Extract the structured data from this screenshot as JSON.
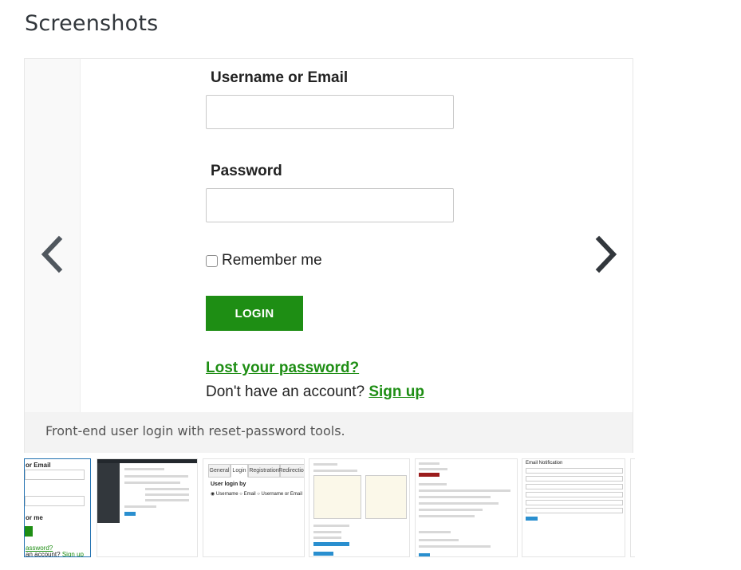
{
  "section": {
    "title": "Screenshots"
  },
  "slide": {
    "username_label": "Username or Email",
    "password_label": "Password",
    "remember_label": "Remember me",
    "login_button": "LOGIN",
    "lost_password": "Lost your password?",
    "no_account": "Don't have an account?",
    "signup_link": "Sign up",
    "caption": "Front-end user login with reset-password tools."
  },
  "navigation": {
    "prev_icon": "chevron-left-icon",
    "next_icon": "chevron-right-icon"
  },
  "thumb1": {
    "label_fragment": "or Email",
    "remember_fragment": "or me",
    "lost_fragment": "assword?",
    "account_fragment": "an account?",
    "signup": "Sign up"
  },
  "thumb3": {
    "tabs": [
      "General",
      "Login",
      "Registration",
      "Redirection"
    ],
    "heading": "User login by",
    "options": [
      "Username",
      "Email",
      "Username or Email"
    ]
  },
  "thumb6": {
    "heading": "Email Notification"
  },
  "colors": {
    "accent_green": "#1e8e14",
    "active_thumb_border": "#2271b1",
    "caption_bg": "#f3f3f3"
  }
}
